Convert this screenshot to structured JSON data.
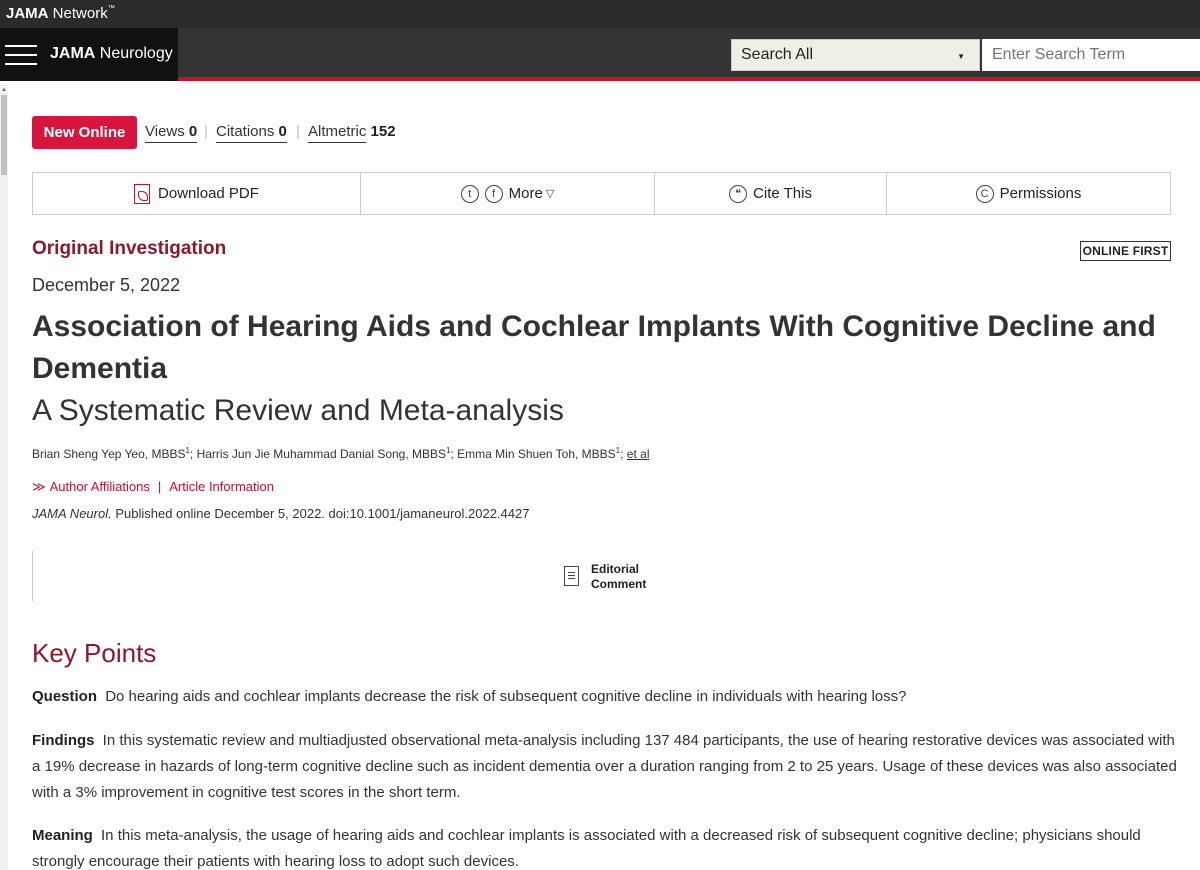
{
  "network": {
    "brand_bold": "JAMA",
    "brand_rest": " Network",
    "tm": "™"
  },
  "journal": {
    "name_bold": "JAMA",
    "name_rest": " Neurology"
  },
  "search": {
    "scope": "Search All",
    "placeholder": "Enter Search Term"
  },
  "metrics": {
    "badge": "New Online",
    "views_label": "Views",
    "views_value": "0",
    "citations_label": "Citations",
    "citations_value": "0",
    "altmetric_label": "Altmetric",
    "altmetric_value": "152"
  },
  "toolbar": {
    "download": "Download PDF",
    "more": "More",
    "cite": "Cite This",
    "permissions": "Permissions"
  },
  "article": {
    "type": "Original Investigation",
    "badge": "ONLINE FIRST",
    "date": "December 5, 2022",
    "title": "Association of Hearing Aids and Cochlear Implants With Cognitive Decline and Dementia",
    "subtitle": "A Systematic Review and Meta-analysis",
    "author1": "Brian Sheng Yep Yeo, MBBS",
    "author2": "; Harris Jun Jie Muhammad Danial Song, MBBS",
    "author3": "; Emma Min Shuen Toh, MBBS",
    "author_sup": "1",
    "etal": "et al",
    "affiliations": "Author Affiliations",
    "article_info": "Article Information",
    "journal_abbrev": "JAMA Neurol.",
    "citation": " Published online December 5, 2022. doi:10.1001/jamaneurol.2022.4427",
    "editorial_line1": "Editorial",
    "editorial_line2": "Comment"
  },
  "key_points": {
    "heading": "Key Points",
    "question_label": "Question",
    "question": "Do hearing aids and cochlear implants decrease the risk of subsequent cognitive decline in individuals with hearing loss?",
    "findings_label": "Findings",
    "findings": "In this systematic review and multiadjusted observational meta-analysis including 137 484 participants, the use of hearing restorative devices was associated with a 19% decrease in hazards of long-term cognitive decline such as incident dementia over a duration ranging from 2 to 25 years. Usage of these devices was also associated with a 3% improvement in cognitive test scores in the short term.",
    "meaning_label": "Meaning",
    "meaning": "In this meta-analysis, the usage of hearing aids and cochlear implants is associated with a decreased risk of subsequent cognitive decline; physicians should strongly encourage their patients with hearing loss to adopt such devices."
  }
}
